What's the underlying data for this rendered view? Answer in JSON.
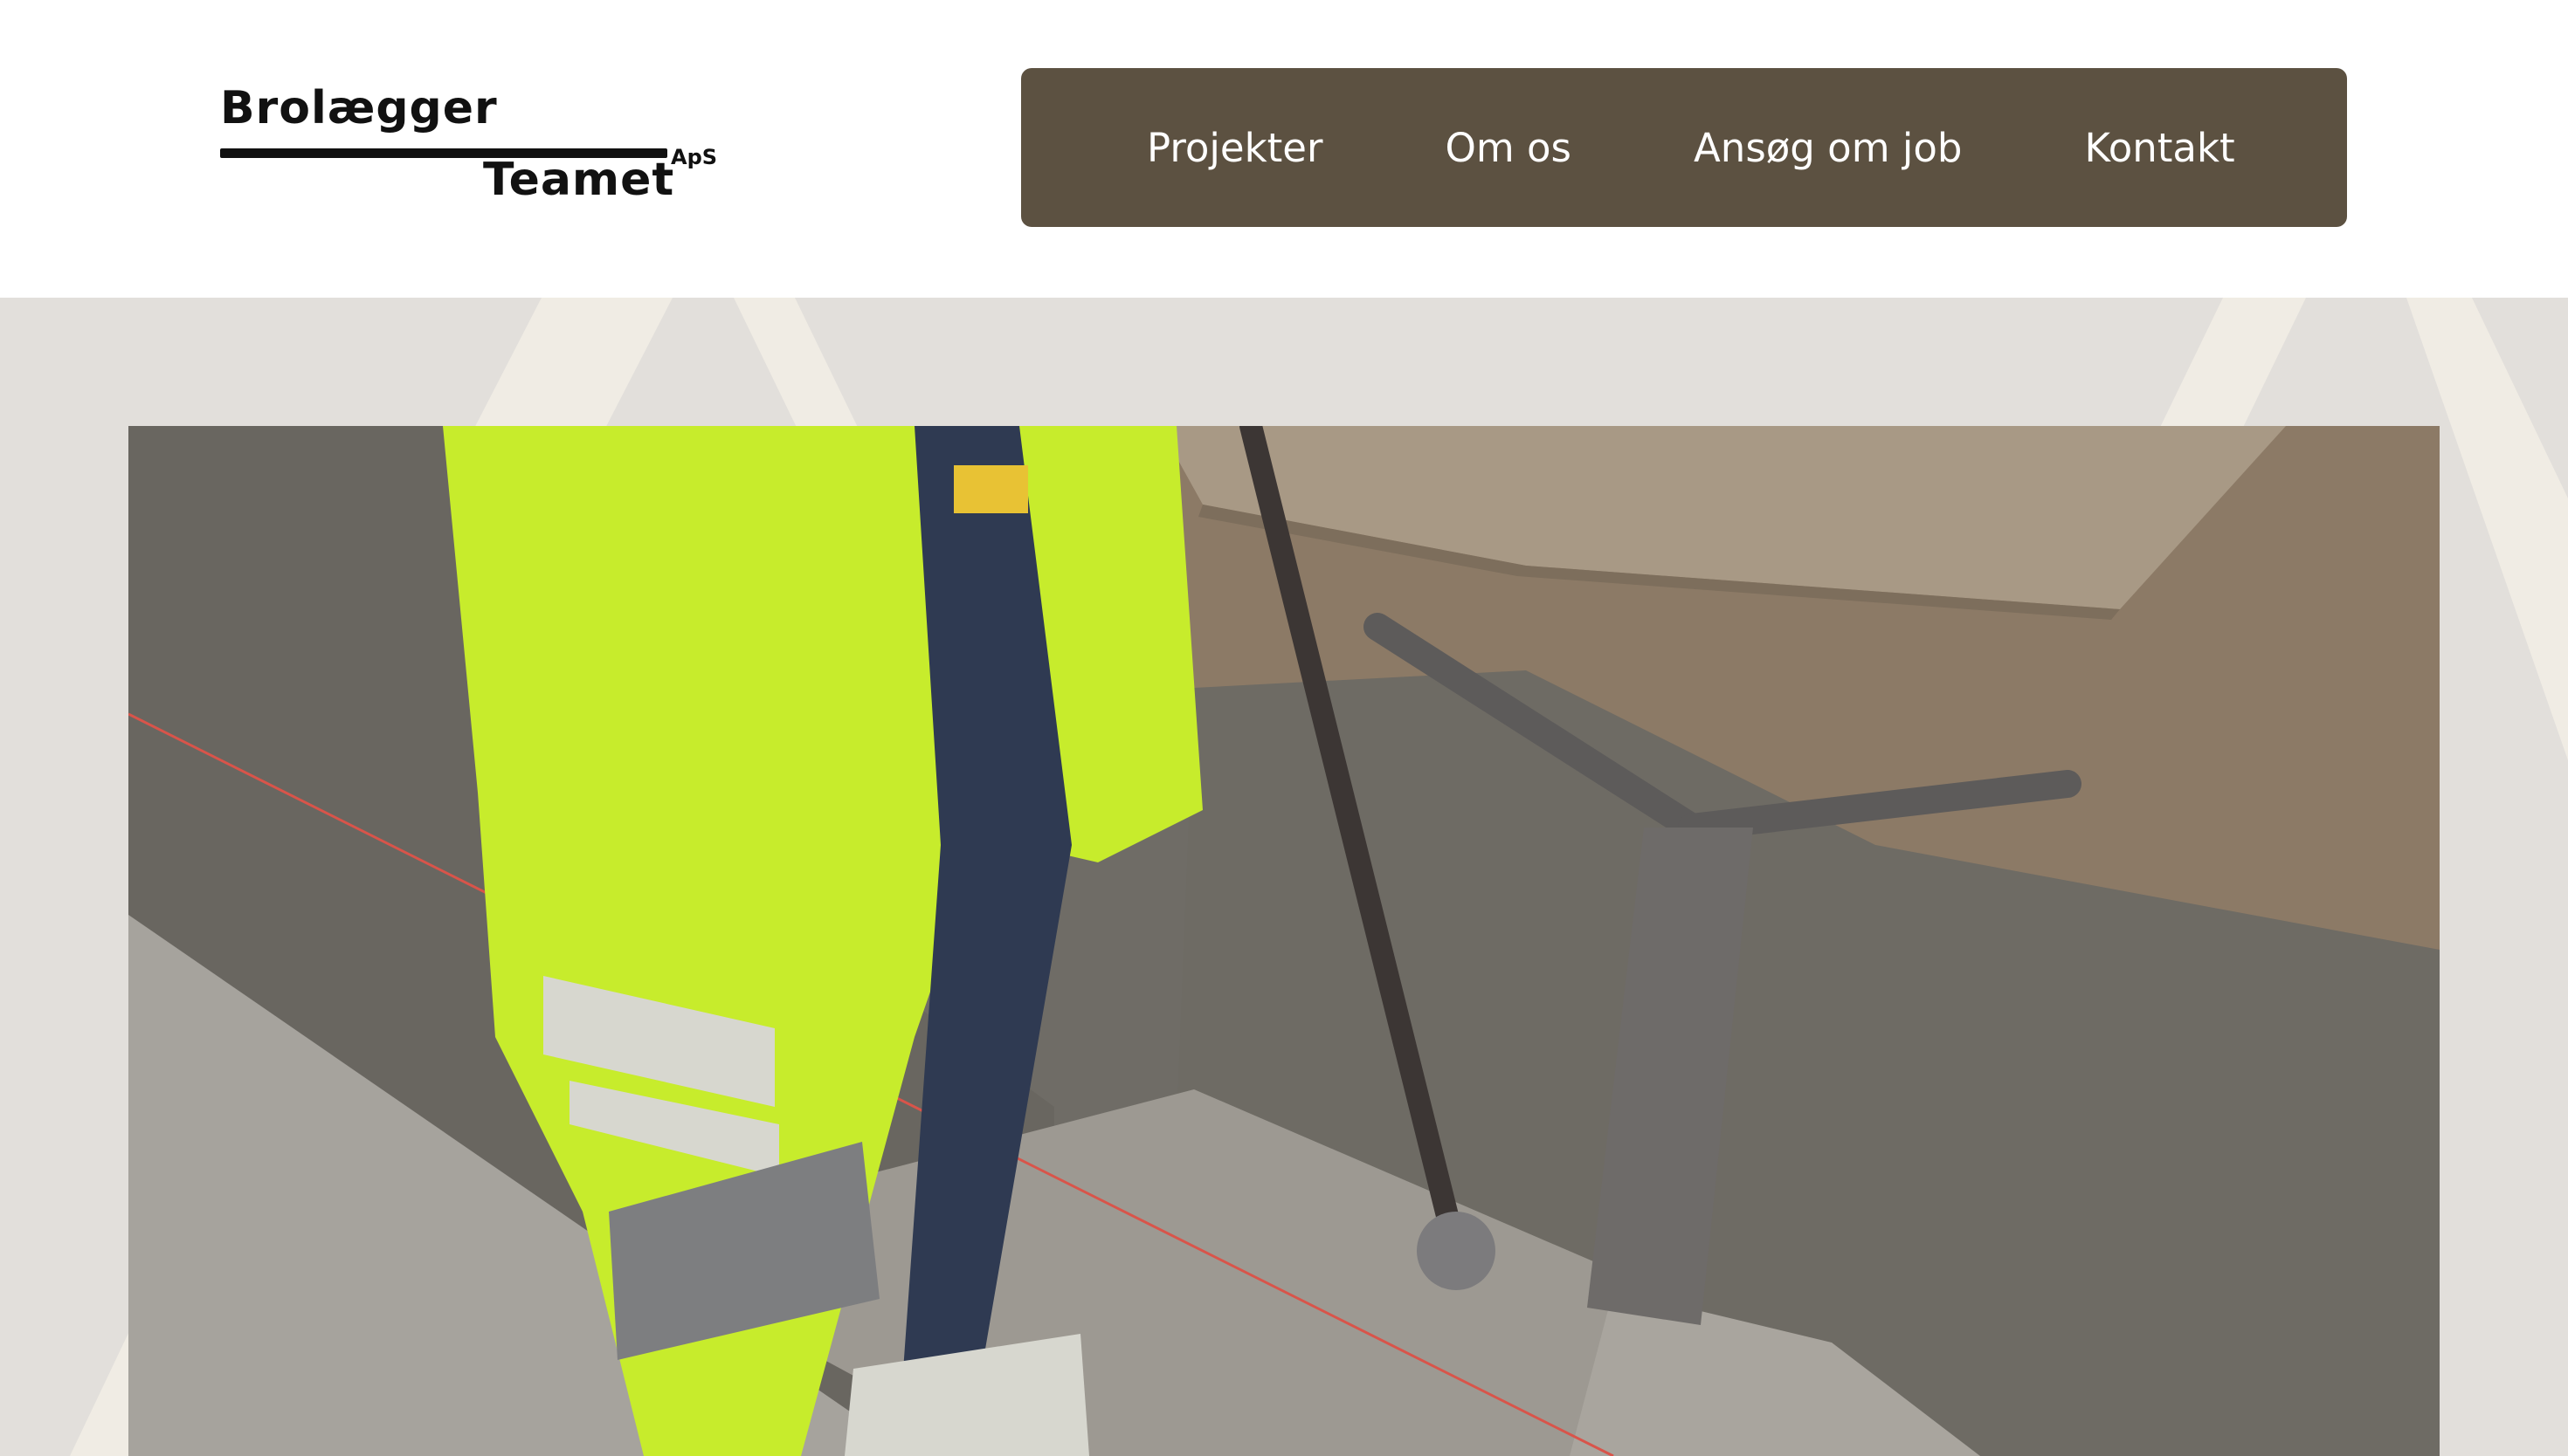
{
  "header": {
    "logo": {
      "line1": "Brolægger",
      "line2": "Teamet",
      "suffix": "ApS"
    },
    "nav": {
      "items": [
        {
          "label": "Projekter"
        },
        {
          "label": "Om os"
        },
        {
          "label": "Ansøg om job"
        },
        {
          "label": "Kontakt"
        }
      ]
    }
  },
  "hero": {
    "image_icon": "construction-photo"
  },
  "colors": {
    "nav_background": "#5c5141",
    "hero_background": "#e2dfdb",
    "decor_stripes": "#f0ece4",
    "nav_text": "#ffffff"
  }
}
